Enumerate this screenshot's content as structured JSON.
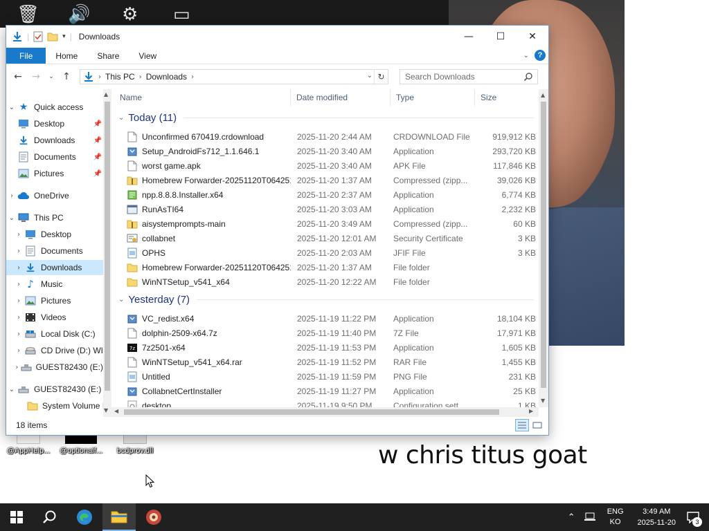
{
  "window": {
    "title": "Downloads",
    "ribbon_tabs": [
      "File",
      "Home",
      "Share",
      "View"
    ],
    "help_glyph": "?",
    "address": {
      "crumbs": [
        "This PC",
        "Downloads"
      ]
    },
    "search_placeholder": "Search Downloads",
    "columns": [
      "Name",
      "Date modified",
      "Type",
      "Size"
    ],
    "status": "18 items"
  },
  "nav": {
    "quick_access": "Quick access",
    "quick_items": [
      "Desktop",
      "Downloads",
      "Documents",
      "Pictures"
    ],
    "onedrive": "OneDrive",
    "this_pc": "This PC",
    "pc_items": [
      "Desktop",
      "Documents",
      "Downloads",
      "Music",
      "Pictures",
      "Videos",
      "Local Disk (C:)",
      "CD Drive (D:) WI",
      "GUEST82430 (E:)"
    ],
    "drive": "GUEST82430 (E:)",
    "drive_child": "System Volume I"
  },
  "groups": {
    "today": "Today (11)",
    "yesterday": "Yesterday (7)"
  },
  "files_today": [
    {
      "name": "Unconfirmed 670419.crdownload",
      "date": "2025-11-20 2:44 AM",
      "type": "CRDOWNLOAD File",
      "size": "919,912 KB",
      "icon": "blank-file-icon"
    },
    {
      "name": "Setup_AndroidFs712_1.1.646.1",
      "date": "2025-11-20 3:40 AM",
      "type": "Application",
      "size": "293,720 KB",
      "icon": "installer-icon"
    },
    {
      "name": "worst game.apk",
      "date": "2025-11-20 3:40 AM",
      "type": "APK File",
      "size": "117,846 KB",
      "icon": "blank-file-icon"
    },
    {
      "name": "Homebrew Forwarder-20251120T064251Z...",
      "date": "2025-11-20 1:37 AM",
      "type": "Compressed (zipp...",
      "size": "39,026 KB",
      "icon": "zip-folder-icon"
    },
    {
      "name": "npp.8.8.8.Installer.x64",
      "date": "2025-11-20 2:37 AM",
      "type": "Application",
      "size": "6,774 KB",
      "icon": "notepad-plus-icon"
    },
    {
      "name": "RunAsTI64",
      "date": "2025-11-20 3:03 AM",
      "type": "Application",
      "size": "2,232 KB",
      "icon": "app-icon"
    },
    {
      "name": "aisystemprompts-main",
      "date": "2025-11-20 3:49 AM",
      "type": "Compressed (zipp...",
      "size": "60 KB",
      "icon": "zip-folder-icon"
    },
    {
      "name": "collabnet",
      "date": "2025-11-20 12:01 AM",
      "type": "Security Certificate",
      "size": "3 KB",
      "icon": "certificate-icon"
    },
    {
      "name": "OPHS",
      "date": "2025-11-20 2:03 AM",
      "type": "JFIF File",
      "size": "3 KB",
      "icon": "image-file-icon"
    },
    {
      "name": "Homebrew Forwarder-20251120T064251Z...",
      "date": "2025-11-20 1:37 AM",
      "type": "File folder",
      "size": "",
      "icon": "folder-icon"
    },
    {
      "name": "WinNTSetup_v541_x64",
      "date": "2025-11-20 12:22 AM",
      "type": "File folder",
      "size": "",
      "icon": "folder-icon"
    }
  ],
  "files_yesterday": [
    {
      "name": "VC_redist.x64",
      "date": "2025-11-19 11:22 PM",
      "type": "Application",
      "size": "18,104 KB",
      "icon": "installer-icon"
    },
    {
      "name": "dolphin-2509-x64.7z",
      "date": "2025-11-19 11:40 PM",
      "type": "7Z File",
      "size": "17,971 KB",
      "icon": "blank-file-icon"
    },
    {
      "name": "7z2501-x64",
      "date": "2025-11-19 11:53 PM",
      "type": "Application",
      "size": "1,605 KB",
      "icon": "sevenzip-icon"
    },
    {
      "name": "WinNTSetup_v541_x64.rar",
      "date": "2025-11-19 11:52 PM",
      "type": "RAR File",
      "size": "1,455 KB",
      "icon": "blank-file-icon"
    },
    {
      "name": "Untitled",
      "date": "2025-11-19 11:59 PM",
      "type": "PNG File",
      "size": "231 KB",
      "icon": "image-file-icon"
    },
    {
      "name": "CollabnetCertInstaller",
      "date": "2025-11-19 11:27 PM",
      "type": "Application",
      "size": "25 KB",
      "icon": "installer-icon"
    },
    {
      "name": "desktop",
      "date": "2025-11-19 9:50 PM",
      "type": "Configuration sett...",
      "size": "1 KB",
      "icon": "config-file-icon"
    }
  ],
  "desktop": {
    "icons": [
      "@AppHelp...",
      "@optionalf...",
      "bcdprov.dll"
    ],
    "caption": "w chris titus goat"
  },
  "taskbar": {
    "lang_top": "ENG",
    "lang_bottom": "KO",
    "time": "3:49 AM",
    "date": "2025-11-20",
    "notification_count": "3"
  },
  "colors": {
    "accent": "#1979ca",
    "selection": "#cce8ff",
    "folder": "#f8d775",
    "taskbar": "#202020"
  }
}
